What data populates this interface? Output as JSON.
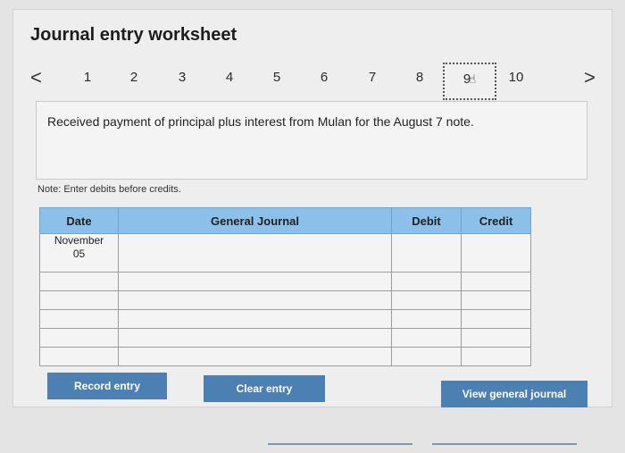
{
  "header": {
    "title": "Journal entry worksheet"
  },
  "pager": {
    "prev_icon": "chevron-left-icon",
    "next_icon": "chevron-right-icon",
    "prev_glyph": "<",
    "next_glyph": ">",
    "pages": [
      "1",
      "2",
      "3",
      "4",
      "5",
      "6",
      "7",
      "8",
      "10"
    ],
    "current_page": "9",
    "cursor_icon": "hand-cursor-icon"
  },
  "transaction": {
    "description": "Received payment of principal plus interest from Mulan for the August 7 note."
  },
  "note": "Note: Enter debits before credits.",
  "journal": {
    "headers": {
      "date": "Date",
      "account": "General Journal",
      "debit": "Debit",
      "credit": "Credit"
    },
    "date_month": "November",
    "date_day": "05"
  },
  "buttons": {
    "record": "Record entry",
    "clear": "Clear entry",
    "view": "View general journal"
  },
  "colors": {
    "header_blue": "#8cc0e8",
    "button_blue": "#4c80b3"
  }
}
